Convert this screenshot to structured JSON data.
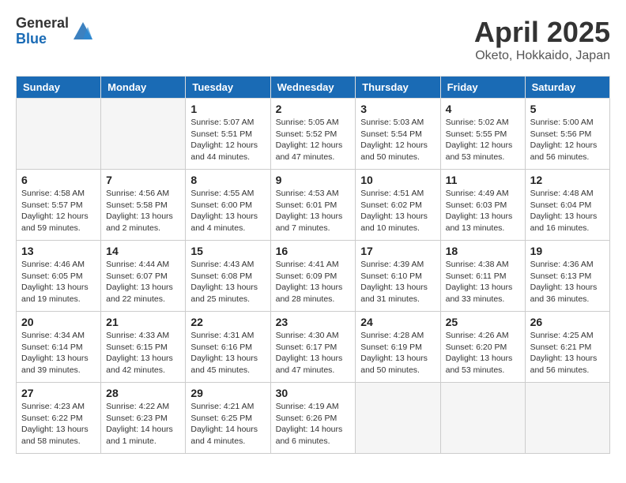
{
  "logo": {
    "general": "General",
    "blue": "Blue"
  },
  "title": "April 2025",
  "location": "Oketo, Hokkaido, Japan",
  "days_header": [
    "Sunday",
    "Monday",
    "Tuesday",
    "Wednesday",
    "Thursday",
    "Friday",
    "Saturday"
  ],
  "weeks": [
    [
      {
        "day": "",
        "info": ""
      },
      {
        "day": "",
        "info": ""
      },
      {
        "day": "1",
        "info": "Sunrise: 5:07 AM\nSunset: 5:51 PM\nDaylight: 12 hours and 44 minutes."
      },
      {
        "day": "2",
        "info": "Sunrise: 5:05 AM\nSunset: 5:52 PM\nDaylight: 12 hours and 47 minutes."
      },
      {
        "day": "3",
        "info": "Sunrise: 5:03 AM\nSunset: 5:54 PM\nDaylight: 12 hours and 50 minutes."
      },
      {
        "day": "4",
        "info": "Sunrise: 5:02 AM\nSunset: 5:55 PM\nDaylight: 12 hours and 53 minutes."
      },
      {
        "day": "5",
        "info": "Sunrise: 5:00 AM\nSunset: 5:56 PM\nDaylight: 12 hours and 56 minutes."
      }
    ],
    [
      {
        "day": "6",
        "info": "Sunrise: 4:58 AM\nSunset: 5:57 PM\nDaylight: 12 hours and 59 minutes."
      },
      {
        "day": "7",
        "info": "Sunrise: 4:56 AM\nSunset: 5:58 PM\nDaylight: 13 hours and 2 minutes."
      },
      {
        "day": "8",
        "info": "Sunrise: 4:55 AM\nSunset: 6:00 PM\nDaylight: 13 hours and 4 minutes."
      },
      {
        "day": "9",
        "info": "Sunrise: 4:53 AM\nSunset: 6:01 PM\nDaylight: 13 hours and 7 minutes."
      },
      {
        "day": "10",
        "info": "Sunrise: 4:51 AM\nSunset: 6:02 PM\nDaylight: 13 hours and 10 minutes."
      },
      {
        "day": "11",
        "info": "Sunrise: 4:49 AM\nSunset: 6:03 PM\nDaylight: 13 hours and 13 minutes."
      },
      {
        "day": "12",
        "info": "Sunrise: 4:48 AM\nSunset: 6:04 PM\nDaylight: 13 hours and 16 minutes."
      }
    ],
    [
      {
        "day": "13",
        "info": "Sunrise: 4:46 AM\nSunset: 6:05 PM\nDaylight: 13 hours and 19 minutes."
      },
      {
        "day": "14",
        "info": "Sunrise: 4:44 AM\nSunset: 6:07 PM\nDaylight: 13 hours and 22 minutes."
      },
      {
        "day": "15",
        "info": "Sunrise: 4:43 AM\nSunset: 6:08 PM\nDaylight: 13 hours and 25 minutes."
      },
      {
        "day": "16",
        "info": "Sunrise: 4:41 AM\nSunset: 6:09 PM\nDaylight: 13 hours and 28 minutes."
      },
      {
        "day": "17",
        "info": "Sunrise: 4:39 AM\nSunset: 6:10 PM\nDaylight: 13 hours and 31 minutes."
      },
      {
        "day": "18",
        "info": "Sunrise: 4:38 AM\nSunset: 6:11 PM\nDaylight: 13 hours and 33 minutes."
      },
      {
        "day": "19",
        "info": "Sunrise: 4:36 AM\nSunset: 6:13 PM\nDaylight: 13 hours and 36 minutes."
      }
    ],
    [
      {
        "day": "20",
        "info": "Sunrise: 4:34 AM\nSunset: 6:14 PM\nDaylight: 13 hours and 39 minutes."
      },
      {
        "day": "21",
        "info": "Sunrise: 4:33 AM\nSunset: 6:15 PM\nDaylight: 13 hours and 42 minutes."
      },
      {
        "day": "22",
        "info": "Sunrise: 4:31 AM\nSunset: 6:16 PM\nDaylight: 13 hours and 45 minutes."
      },
      {
        "day": "23",
        "info": "Sunrise: 4:30 AM\nSunset: 6:17 PM\nDaylight: 13 hours and 47 minutes."
      },
      {
        "day": "24",
        "info": "Sunrise: 4:28 AM\nSunset: 6:19 PM\nDaylight: 13 hours and 50 minutes."
      },
      {
        "day": "25",
        "info": "Sunrise: 4:26 AM\nSunset: 6:20 PM\nDaylight: 13 hours and 53 minutes."
      },
      {
        "day": "26",
        "info": "Sunrise: 4:25 AM\nSunset: 6:21 PM\nDaylight: 13 hours and 56 minutes."
      }
    ],
    [
      {
        "day": "27",
        "info": "Sunrise: 4:23 AM\nSunset: 6:22 PM\nDaylight: 13 hours and 58 minutes."
      },
      {
        "day": "28",
        "info": "Sunrise: 4:22 AM\nSunset: 6:23 PM\nDaylight: 14 hours and 1 minute."
      },
      {
        "day": "29",
        "info": "Sunrise: 4:21 AM\nSunset: 6:25 PM\nDaylight: 14 hours and 4 minutes."
      },
      {
        "day": "30",
        "info": "Sunrise: 4:19 AM\nSunset: 6:26 PM\nDaylight: 14 hours and 6 minutes."
      },
      {
        "day": "",
        "info": ""
      },
      {
        "day": "",
        "info": ""
      },
      {
        "day": "",
        "info": ""
      }
    ]
  ]
}
